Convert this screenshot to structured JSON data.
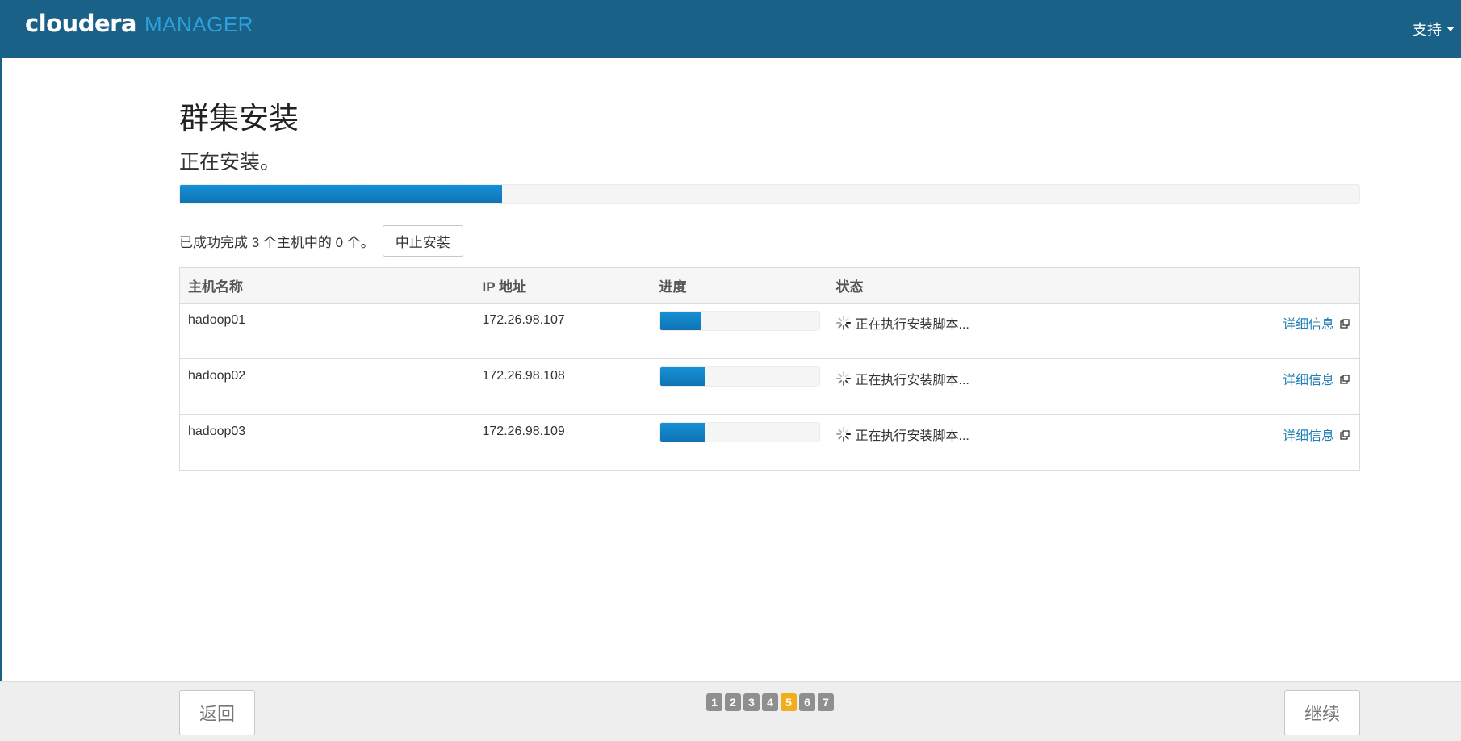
{
  "header": {
    "logo_brand": "cloudera",
    "logo_product": "MANAGER",
    "support_label": "支持"
  },
  "page": {
    "title": "群集安装",
    "subtitle": "正在安装。",
    "overall_progress": 0.273
  },
  "summary": {
    "text": "已成功完成 3 个主机中的 0 个。",
    "abort_label": "中止安装"
  },
  "table": {
    "columns": [
      "主机名称",
      "IP 地址",
      "进度",
      "状态",
      ""
    ],
    "rows": [
      {
        "host": "hadoop01",
        "ip": "172.26.98.107",
        "progress": 0.26,
        "status": "正在执行安装脚本...",
        "details": "详细信息"
      },
      {
        "host": "hadoop02",
        "ip": "172.26.98.108",
        "progress": 0.28,
        "status": "正在执行安装脚本...",
        "details": "详细信息"
      },
      {
        "host": "hadoop03",
        "ip": "172.26.98.109",
        "progress": 0.28,
        "status": "正在执行安装脚本...",
        "details": "详细信息"
      }
    ]
  },
  "footer": {
    "back_label": "返回",
    "continue_label": "继续",
    "steps": [
      "1",
      "2",
      "3",
      "4",
      "5",
      "6",
      "7"
    ],
    "active_step": "5"
  },
  "colors": {
    "header_bg": "#1a6188",
    "accent": "#2ca0dd",
    "progress_fill": "#0f74b3",
    "active_step": "#f0ad1c",
    "link": "#1f7fb4"
  },
  "icons": {
    "spinner": "spinner-icon",
    "external_link": "external-link-icon",
    "support_caret": "caret-down-icon"
  }
}
